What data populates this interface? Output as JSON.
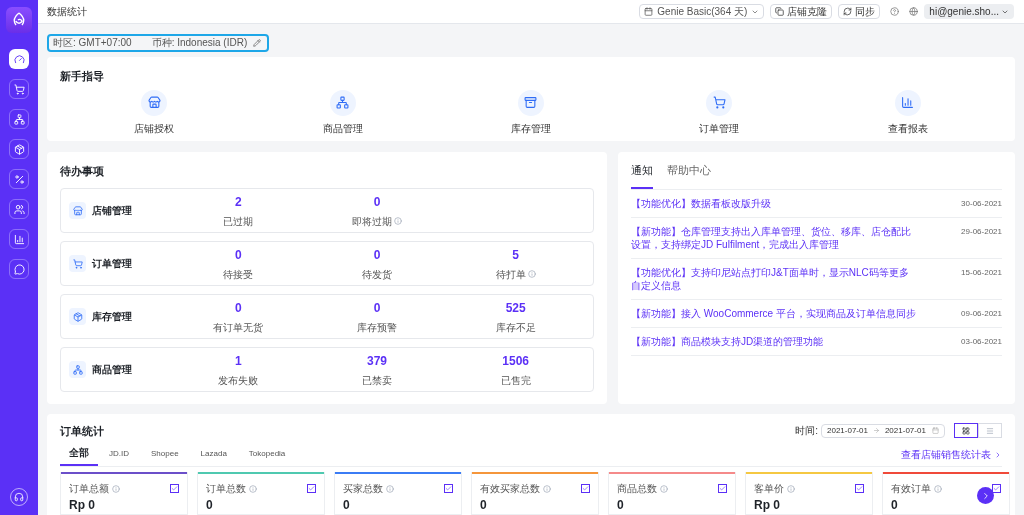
{
  "topbar": {
    "title": "数据统计",
    "plan": "Genie Basic(364 天)",
    "clone_button": "店铺克隆",
    "sync_button": "同步",
    "account": "hi@genie.sho..."
  },
  "settings": {
    "timezone": "时区: GMT+07:00",
    "currency": "币种: Indonesia (IDR)"
  },
  "sidebar": {
    "items": [
      {
        "kind": "dashboard",
        "selected": true
      },
      {
        "kind": "cart",
        "selected": false
      },
      {
        "kind": "network",
        "selected": false
      },
      {
        "kind": "box",
        "selected": false
      },
      {
        "kind": "percent",
        "selected": false
      },
      {
        "kind": "users",
        "selected": false
      },
      {
        "kind": "chart",
        "selected": false
      },
      {
        "kind": "message",
        "selected": false
      }
    ]
  },
  "guide": {
    "title": "新手指导",
    "items": [
      {
        "kind": "store",
        "label": "店铺授权"
      },
      {
        "kind": "network",
        "label": "商品管理"
      },
      {
        "kind": "inbox",
        "label": "库存管理"
      },
      {
        "kind": "cart",
        "label": "订单管理"
      },
      {
        "kind": "chart",
        "label": "查看报表"
      }
    ]
  },
  "todo": {
    "title": "待办事项",
    "groups": [
      {
        "kind": "store",
        "title": "店铺管理",
        "stats": [
          {
            "value": "2",
            "label": "已过期",
            "kind": "plain"
          },
          {
            "value": "0",
            "label": "即将过期",
            "kind": "info"
          }
        ]
      },
      {
        "kind": "cart",
        "title": "订单管理",
        "stats": [
          {
            "value": "0",
            "label": "待接受",
            "kind": "plain"
          },
          {
            "value": "0",
            "label": "待发货",
            "kind": "plain"
          },
          {
            "value": "5",
            "label": "待打单",
            "kind": "info"
          }
        ]
      },
      {
        "kind": "box",
        "title": "库存管理",
        "stats": [
          {
            "value": "0",
            "label": "有订单无货",
            "kind": "plain"
          },
          {
            "value": "0",
            "label": "库存预警",
            "kind": "plain"
          },
          {
            "value": "525",
            "label": "库存不足",
            "kind": "plain"
          }
        ]
      },
      {
        "kind": "network",
        "title": "商品管理",
        "stats": [
          {
            "value": "1",
            "label": "发布失败",
            "kind": "plain"
          },
          {
            "value": "379",
            "label": "已禁卖",
            "kind": "plain"
          },
          {
            "value": "1506",
            "label": "已售完",
            "kind": "plain"
          }
        ]
      }
    ]
  },
  "notices": {
    "tabs": [
      {
        "label": "通知",
        "selected": true
      },
      {
        "label": "帮助中心",
        "selected": false
      }
    ],
    "items": [
      {
        "text": "【功能优化】数据看板改版升级",
        "date": "30-06-2021"
      },
      {
        "text": "【新功能】仓库管理支持出入库单管理、货位、移库、店仓配比设置，支持绑定JD Fulfilment，完成出入库管理",
        "date": "29-06-2021"
      },
      {
        "text": "【功能优化】支持印尼站点打印J&T面单时，显示NLC码等更多自定义信息",
        "date": "15-06-2021"
      },
      {
        "text": "【新功能】接入 WooCommerce 平台，实现商品及订单信息同步",
        "date": "09-06-2021"
      },
      {
        "text": "【新功能】商品模块支持JD渠道的管理功能",
        "date": "03-06-2021"
      }
    ]
  },
  "orders": {
    "title": "订单统计",
    "time_label": "时间:",
    "date_from": "2021-07-01",
    "date_to": "2021-07-01",
    "views": [
      {
        "kind": "grid",
        "selected": true
      },
      {
        "kind": "list",
        "selected": false
      }
    ],
    "tabs": [
      {
        "label": "全部",
        "selected": true
      },
      {
        "label": "JD.ID",
        "selected": false
      },
      {
        "label": "Shopee",
        "selected": false
      },
      {
        "label": "Lazada",
        "selected": false
      },
      {
        "label": "Tokopedia",
        "selected": false
      }
    ],
    "report_link": "查看店铺销售统计表",
    "cards": [
      {
        "label": "订单总额",
        "value": "Rp 0",
        "color": "#6b4fc9",
        "checked": true
      },
      {
        "label": "订单总数",
        "value": "0",
        "color": "#4fc9b0",
        "checked": true
      },
      {
        "label": "买家总数",
        "value": "0",
        "color": "#3b7cf5",
        "checked": true
      },
      {
        "label": "有效买家总数",
        "value": "0",
        "color": "#f5963b",
        "checked": true
      },
      {
        "label": "商品总数",
        "value": "0",
        "color": "#f58a8a",
        "checked": true
      },
      {
        "label": "客单价",
        "value": "Rp 0",
        "color": "#f5c842",
        "checked": true
      },
      {
        "label": "有效订单",
        "value": "0",
        "color": "#f04a3a",
        "checked": true
      }
    ]
  }
}
